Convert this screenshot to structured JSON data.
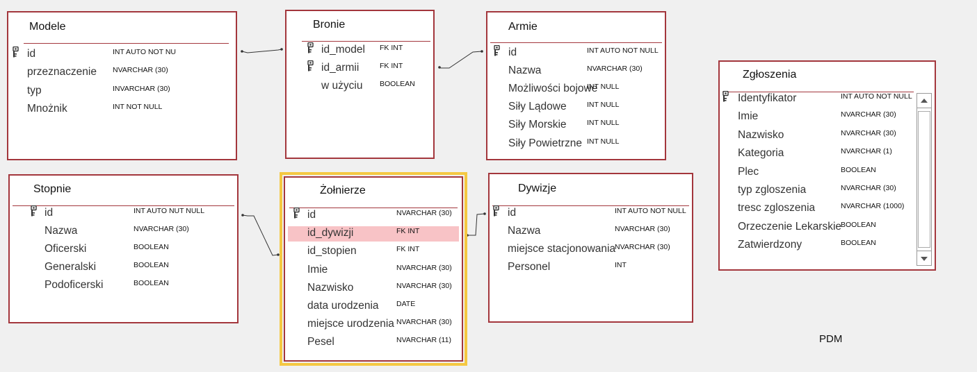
{
  "diagram_label": "PDM",
  "tables": [
    {
      "id": "modele",
      "title": "Modele",
      "selected": false,
      "fields": [
        {
          "name": "id",
          "type": "INT AUTO NOT NU",
          "key": true
        },
        {
          "name": "przeznaczenie",
          "type": "NVARCHAR (30)",
          "key": false
        },
        {
          "name": "typ",
          "type": "INVARCHAR (30)",
          "key": false
        },
        {
          "name": "Mnożnik",
          "type": "INT NOT NULL",
          "key": false
        }
      ]
    },
    {
      "id": "bronie",
      "title": "Bronie",
      "selected": false,
      "fields": [
        {
          "name": "id_model",
          "type": "FK INT",
          "key": true
        },
        {
          "name": "id_armii",
          "type": "FK INT",
          "key": true
        },
        {
          "name": "w użyciu",
          "type": "BOOLEAN",
          "key": false
        }
      ]
    },
    {
      "id": "armie",
      "title": "Armie",
      "selected": false,
      "fields": [
        {
          "name": "id",
          "type": "INT AUTO NOT NULL",
          "key": true
        },
        {
          "name": "Nazwa",
          "type": "NVARCHAR (30)",
          "key": false
        },
        {
          "name": "Możliwości bojowe",
          "type": "INT NULL",
          "key": false
        },
        {
          "name": "Siły Lądowe",
          "type": "INT NULL",
          "key": false
        },
        {
          "name": "Siły Morskie",
          "type": "INT NULL",
          "key": false
        },
        {
          "name": "Siły Powietrzne",
          "type": "INT NULL",
          "key": false
        }
      ]
    },
    {
      "id": "zgloszenia",
      "title": "Zgłoszenia",
      "selected": false,
      "fields": [
        {
          "name": "Identyfikator",
          "type": "INT AUTO NOT NULL",
          "key": true
        },
        {
          "name": "Imie",
          "type": "NVARCHAR (30)",
          "key": false
        },
        {
          "name": "Nazwisko",
          "type": "NVARCHAR (30)",
          "key": false
        },
        {
          "name": "Kategoria",
          "type": "NVARCHAR (1)",
          "key": false
        },
        {
          "name": "Plec",
          "type": "BOOLEAN",
          "key": false
        },
        {
          "name": "typ zgloszenia",
          "type": "NVARCHAR (30)",
          "key": false
        },
        {
          "name": "tresc zgloszenia",
          "type": "NVARCHAR (1000)",
          "key": false
        },
        {
          "name": "Orzeczenie Lekarskie",
          "type": "BOOLEAN",
          "key": false
        },
        {
          "name": "Zatwierdzony",
          "type": "BOOLEAN",
          "key": false
        }
      ]
    },
    {
      "id": "stopnie",
      "title": "Stopnie",
      "selected": false,
      "fields": [
        {
          "name": "id",
          "type": "INT AUTO NUT NULL",
          "key": true
        },
        {
          "name": "Nazwa",
          "type": "NVARCHAR (30)",
          "key": false
        },
        {
          "name": "Oficerski",
          "type": "BOOLEAN",
          "key": false
        },
        {
          "name": "Generalski",
          "type": "BOOLEAN",
          "key": false
        },
        {
          "name": "Podoficerski",
          "type": "BOOLEAN",
          "key": false
        }
      ]
    },
    {
      "id": "zolnierze",
      "title": "Żołnierze",
      "selected": true,
      "fields": [
        {
          "name": "id",
          "type": "NVARCHAR (30)",
          "key": true
        },
        {
          "name": "id_dywizji",
          "type": "FK INT",
          "key": false,
          "highlighted": true
        },
        {
          "name": "id_stopien",
          "type": "FK INT",
          "key": false
        },
        {
          "name": "Imie",
          "type": "NVARCHAR (30)",
          "key": false
        },
        {
          "name": "Nazwisko",
          "type": "NVARCHAR (30)",
          "key": false
        },
        {
          "name": "data urodzenia",
          "type": "DATE",
          "key": false
        },
        {
          "name": "miejsce urodzenia",
          "type": "NVARCHAR (30)",
          "key": false
        },
        {
          "name": "Pesel",
          "type": "NVARCHAR (11)",
          "key": false
        }
      ]
    },
    {
      "id": "dywizje",
      "title": "Dywizje",
      "selected": false,
      "fields": [
        {
          "name": "id",
          "type": "INT AUTO NOT NULL",
          "key": true
        },
        {
          "name": "Nazwa",
          "type": "NVARCHAR (30)",
          "key": false
        },
        {
          "name": "miejsce stacjonowania",
          "type": "NVARCHAR (30)",
          "key": false
        },
        {
          "name": "Personel",
          "type": "INT",
          "key": false
        }
      ]
    }
  ],
  "relationships": [
    {
      "from": "modele",
      "to": "bronie"
    },
    {
      "from": "bronie",
      "to": "armie"
    },
    {
      "from": "stopnie",
      "to": "zolnierze"
    },
    {
      "from": "zolnierze",
      "to": "dywizje"
    }
  ],
  "colors": {
    "border": "#a3363c",
    "selection": "#f5c842",
    "highlight_row": "#f8c3c6",
    "background": "#f0f0f0"
  },
  "icons": {
    "key": "key-icon",
    "scroll_up": "triangle-up-icon",
    "scroll_down": "triangle-down-icon"
  }
}
